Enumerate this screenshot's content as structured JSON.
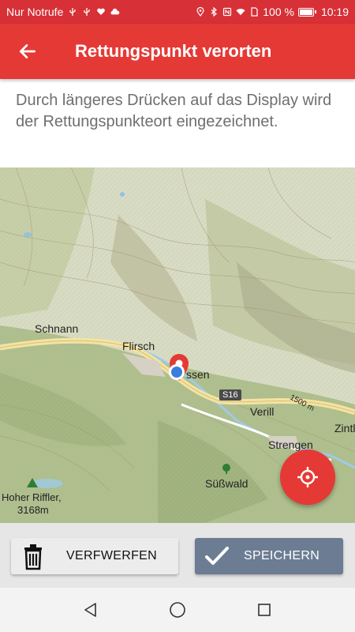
{
  "status_bar": {
    "carrier": "Nur Notrufe",
    "battery_percent": "100 %",
    "time": "10:19"
  },
  "app_bar": {
    "title": "Rettungspunkt verorten"
  },
  "instruction": {
    "text": "Durch längeres Drücken auf das Display wird der Rettungspunkteort eingezeichnet."
  },
  "map": {
    "labels": {
      "schnann": "Schnann",
      "flirsch": "Flirsch",
      "ssen": "ssen",
      "verill": "Verill",
      "strengen": "Strengen",
      "suesswald": "Süßwald",
      "zintl": "Zintl",
      "peak_name": "Hoher Riffler,",
      "peak_elevation": "3168m",
      "road": "S16",
      "road_length": "1500 m"
    }
  },
  "actions": {
    "discard_label": "VERFWERFEN",
    "save_label": "SPEICHERN"
  },
  "colors": {
    "primary": "#e53935",
    "status_bar": "#d73036",
    "save_button": "#6b7c93"
  }
}
